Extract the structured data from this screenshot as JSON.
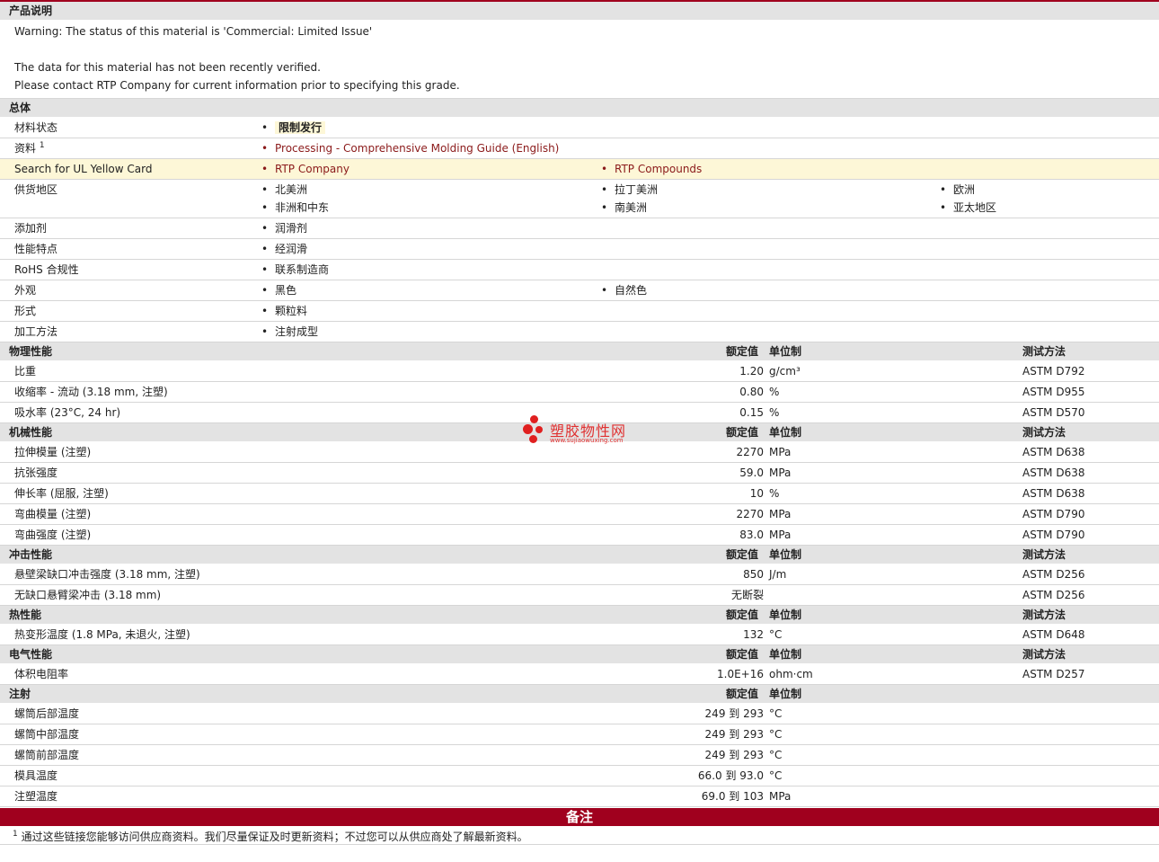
{
  "sections": {
    "product": "产品说明",
    "general": "总体",
    "physical": "物理性能",
    "mechanical": "机械性能",
    "impact": "冲击性能",
    "thermal": "热性能",
    "electrical": "电气性能",
    "injection": "注射"
  },
  "col_headers": {
    "nominal": "额定值",
    "unit": "单位制",
    "test": "测试方法"
  },
  "description": {
    "line1": "Warning: The status of this material is 'Commercial: Limited Issue'",
    "line2": "The data for this material has not been recently verified.",
    "line3": "Please contact RTP Company for current information prior to specifying this grade."
  },
  "general": {
    "status_label": "材料状态",
    "status_value": "限制发行",
    "docs_label": "资料",
    "docs_sup": "1",
    "docs_link": "Processing - Comprehensive Molding Guide (English)",
    "ul_label": "Search for UL Yellow Card",
    "ul_link1": "RTP Company",
    "ul_link2": "RTP Compounds",
    "supply_label": "供货地区",
    "supply": [
      "北美洲",
      "拉丁美洲",
      "欧洲",
      "非洲和中东",
      "南美洲",
      "亚太地区"
    ],
    "additive_label": "添加剂",
    "additive": "润滑剂",
    "feature_label": "性能特点",
    "feature": "经润滑",
    "rohs_label": "RoHS 合规性",
    "rohs": "联系制造商",
    "appearance_label": "外观",
    "appearance": [
      "黑色",
      "自然色"
    ],
    "form_label": "形式",
    "form": "颗粒料",
    "process_label": "加工方法",
    "process": "注射成型"
  },
  "physical": [
    {
      "name": "比重",
      "value": "1.20",
      "unit": "g/cm³",
      "test": "ASTM D792"
    },
    {
      "name": "收缩率  - 流动  (3.18 mm, 注塑)",
      "value": "0.80",
      "unit": "%",
      "test": "ASTM D955"
    },
    {
      "name": "吸水率  (23°C, 24 hr)",
      "value": "0.15",
      "unit": "%",
      "test": "ASTM D570"
    }
  ],
  "mechanical": [
    {
      "name": "拉伸模量  (注塑)",
      "value": "2270",
      "unit": "MPa",
      "test": "ASTM D638"
    },
    {
      "name": "抗张强度",
      "value": "59.0",
      "unit": "MPa",
      "test": "ASTM D638"
    },
    {
      "name": "伸长率  (屈服, 注塑)",
      "value": "10",
      "unit": "%",
      "test": "ASTM D638"
    },
    {
      "name": "弯曲模量  (注塑)",
      "value": "2270",
      "unit": "MPa",
      "test": "ASTM D790"
    },
    {
      "name": "弯曲强度  (注塑)",
      "value": "83.0",
      "unit": "MPa",
      "test": "ASTM D790"
    }
  ],
  "impact": [
    {
      "name": "悬壁梁缺口冲击强度  (3.18 mm, 注塑)",
      "value": "850",
      "unit": "J/m",
      "test": "ASTM D256"
    },
    {
      "name": "无缺口悬臂梁冲击  (3.18 mm)",
      "value": "无断裂",
      "unit": "",
      "test": "ASTM D256"
    }
  ],
  "thermal": [
    {
      "name": "热变形温度  (1.8 MPa, 未退火, 注塑)",
      "value": "132",
      "unit": "°C",
      "test": "ASTM D648"
    }
  ],
  "electrical": [
    {
      "name": "体积电阻率",
      "value": "1.0E+16",
      "unit": "ohm·cm",
      "test": "ASTM D257"
    }
  ],
  "injection": [
    {
      "name": "螺筒后部温度",
      "value": "249 到  293",
      "unit": "°C"
    },
    {
      "name": "螺筒中部温度",
      "value": "249 到  293",
      "unit": "°C"
    },
    {
      "name": "螺筒前部温度",
      "value": "249 到  293",
      "unit": "°C"
    },
    {
      "name": "模具温度",
      "value": "66.0 到  93.0",
      "unit": "°C"
    },
    {
      "name": "注塑温度",
      "value": "69.0 到  103",
      "unit": "MPa"
    }
  ],
  "notes": {
    "title": "备注",
    "sup": "1",
    "text": "通过这些链接您能够访问供应商资料。我们尽量保证及时更新资料；不过您可以从供应商处了解最新资料。"
  },
  "watermark": {
    "text": "塑胶物性网",
    "url": "www.sujiaowuxing.com"
  }
}
